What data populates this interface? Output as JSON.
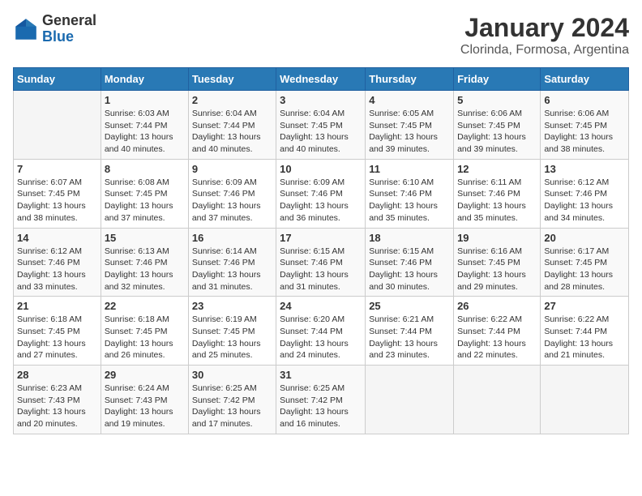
{
  "logo": {
    "general": "General",
    "blue": "Blue"
  },
  "title": "January 2024",
  "subtitle": "Clorinda, Formosa, Argentina",
  "days_header": [
    "Sunday",
    "Monday",
    "Tuesday",
    "Wednesday",
    "Thursday",
    "Friday",
    "Saturday"
  ],
  "weeks": [
    [
      {
        "day": "",
        "sunrise": "",
        "sunset": "",
        "daylight": ""
      },
      {
        "day": "1",
        "sunrise": "Sunrise: 6:03 AM",
        "sunset": "Sunset: 7:44 PM",
        "daylight": "Daylight: 13 hours and 40 minutes."
      },
      {
        "day": "2",
        "sunrise": "Sunrise: 6:04 AM",
        "sunset": "Sunset: 7:44 PM",
        "daylight": "Daylight: 13 hours and 40 minutes."
      },
      {
        "day": "3",
        "sunrise": "Sunrise: 6:04 AM",
        "sunset": "Sunset: 7:45 PM",
        "daylight": "Daylight: 13 hours and 40 minutes."
      },
      {
        "day": "4",
        "sunrise": "Sunrise: 6:05 AM",
        "sunset": "Sunset: 7:45 PM",
        "daylight": "Daylight: 13 hours and 39 minutes."
      },
      {
        "day": "5",
        "sunrise": "Sunrise: 6:06 AM",
        "sunset": "Sunset: 7:45 PM",
        "daylight": "Daylight: 13 hours and 39 minutes."
      },
      {
        "day": "6",
        "sunrise": "Sunrise: 6:06 AM",
        "sunset": "Sunset: 7:45 PM",
        "daylight": "Daylight: 13 hours and 38 minutes."
      }
    ],
    [
      {
        "day": "7",
        "sunrise": "Sunrise: 6:07 AM",
        "sunset": "Sunset: 7:45 PM",
        "daylight": "Daylight: 13 hours and 38 minutes."
      },
      {
        "day": "8",
        "sunrise": "Sunrise: 6:08 AM",
        "sunset": "Sunset: 7:45 PM",
        "daylight": "Daylight: 13 hours and 37 minutes."
      },
      {
        "day": "9",
        "sunrise": "Sunrise: 6:09 AM",
        "sunset": "Sunset: 7:46 PM",
        "daylight": "Daylight: 13 hours and 37 minutes."
      },
      {
        "day": "10",
        "sunrise": "Sunrise: 6:09 AM",
        "sunset": "Sunset: 7:46 PM",
        "daylight": "Daylight: 13 hours and 36 minutes."
      },
      {
        "day": "11",
        "sunrise": "Sunrise: 6:10 AM",
        "sunset": "Sunset: 7:46 PM",
        "daylight": "Daylight: 13 hours and 35 minutes."
      },
      {
        "day": "12",
        "sunrise": "Sunrise: 6:11 AM",
        "sunset": "Sunset: 7:46 PM",
        "daylight": "Daylight: 13 hours and 35 minutes."
      },
      {
        "day": "13",
        "sunrise": "Sunrise: 6:12 AM",
        "sunset": "Sunset: 7:46 PM",
        "daylight": "Daylight: 13 hours and 34 minutes."
      }
    ],
    [
      {
        "day": "14",
        "sunrise": "Sunrise: 6:12 AM",
        "sunset": "Sunset: 7:46 PM",
        "daylight": "Daylight: 13 hours and 33 minutes."
      },
      {
        "day": "15",
        "sunrise": "Sunrise: 6:13 AM",
        "sunset": "Sunset: 7:46 PM",
        "daylight": "Daylight: 13 hours and 32 minutes."
      },
      {
        "day": "16",
        "sunrise": "Sunrise: 6:14 AM",
        "sunset": "Sunset: 7:46 PM",
        "daylight": "Daylight: 13 hours and 31 minutes."
      },
      {
        "day": "17",
        "sunrise": "Sunrise: 6:15 AM",
        "sunset": "Sunset: 7:46 PM",
        "daylight": "Daylight: 13 hours and 31 minutes."
      },
      {
        "day": "18",
        "sunrise": "Sunrise: 6:15 AM",
        "sunset": "Sunset: 7:46 PM",
        "daylight": "Daylight: 13 hours and 30 minutes."
      },
      {
        "day": "19",
        "sunrise": "Sunrise: 6:16 AM",
        "sunset": "Sunset: 7:45 PM",
        "daylight": "Daylight: 13 hours and 29 minutes."
      },
      {
        "day": "20",
        "sunrise": "Sunrise: 6:17 AM",
        "sunset": "Sunset: 7:45 PM",
        "daylight": "Daylight: 13 hours and 28 minutes."
      }
    ],
    [
      {
        "day": "21",
        "sunrise": "Sunrise: 6:18 AM",
        "sunset": "Sunset: 7:45 PM",
        "daylight": "Daylight: 13 hours and 27 minutes."
      },
      {
        "day": "22",
        "sunrise": "Sunrise: 6:18 AM",
        "sunset": "Sunset: 7:45 PM",
        "daylight": "Daylight: 13 hours and 26 minutes."
      },
      {
        "day": "23",
        "sunrise": "Sunrise: 6:19 AM",
        "sunset": "Sunset: 7:45 PM",
        "daylight": "Daylight: 13 hours and 25 minutes."
      },
      {
        "day": "24",
        "sunrise": "Sunrise: 6:20 AM",
        "sunset": "Sunset: 7:44 PM",
        "daylight": "Daylight: 13 hours and 24 minutes."
      },
      {
        "day": "25",
        "sunrise": "Sunrise: 6:21 AM",
        "sunset": "Sunset: 7:44 PM",
        "daylight": "Daylight: 13 hours and 23 minutes."
      },
      {
        "day": "26",
        "sunrise": "Sunrise: 6:22 AM",
        "sunset": "Sunset: 7:44 PM",
        "daylight": "Daylight: 13 hours and 22 minutes."
      },
      {
        "day": "27",
        "sunrise": "Sunrise: 6:22 AM",
        "sunset": "Sunset: 7:44 PM",
        "daylight": "Daylight: 13 hours and 21 minutes."
      }
    ],
    [
      {
        "day": "28",
        "sunrise": "Sunrise: 6:23 AM",
        "sunset": "Sunset: 7:43 PM",
        "daylight": "Daylight: 13 hours and 20 minutes."
      },
      {
        "day": "29",
        "sunrise": "Sunrise: 6:24 AM",
        "sunset": "Sunset: 7:43 PM",
        "daylight": "Daylight: 13 hours and 19 minutes."
      },
      {
        "day": "30",
        "sunrise": "Sunrise: 6:25 AM",
        "sunset": "Sunset: 7:42 PM",
        "daylight": "Daylight: 13 hours and 17 minutes."
      },
      {
        "day": "31",
        "sunrise": "Sunrise: 6:25 AM",
        "sunset": "Sunset: 7:42 PM",
        "daylight": "Daylight: 13 hours and 16 minutes."
      },
      {
        "day": "",
        "sunrise": "",
        "sunset": "",
        "daylight": ""
      },
      {
        "day": "",
        "sunrise": "",
        "sunset": "",
        "daylight": ""
      },
      {
        "day": "",
        "sunrise": "",
        "sunset": "",
        "daylight": ""
      }
    ]
  ]
}
